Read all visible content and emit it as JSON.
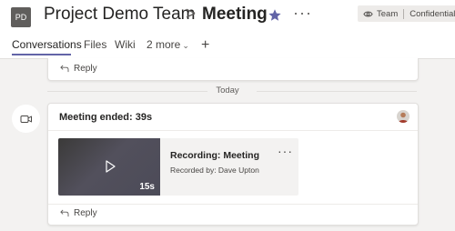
{
  "header": {
    "avatar_initials": "PD",
    "team_name": "Project Demo Team",
    "separator": ">",
    "channel_name": "Meeting",
    "more_label": "···",
    "badge": {
      "icon": "eye-icon",
      "team_label": "Team",
      "classification": "Confidential"
    },
    "star_icon": "star-icon",
    "accent_color": "#6264a7"
  },
  "tabs": [
    {
      "label": "Conversations",
      "active": true
    },
    {
      "label": "Files",
      "active": false
    },
    {
      "label": "Wiki",
      "active": false
    },
    {
      "label": "2 more",
      "active": false
    }
  ],
  "add_tab_label": "+",
  "previous_post": {
    "reply_label": "Reply"
  },
  "date_separator": "Today",
  "meeting_post": {
    "icon": "video-camera-icon",
    "title": "Meeting ended: 39s",
    "recording": {
      "title": "Recording: Meeting",
      "recorded_by": "Recorded by: Dave Upton",
      "duration": "15s",
      "more_label": "···"
    },
    "reply_label": "Reply"
  }
}
